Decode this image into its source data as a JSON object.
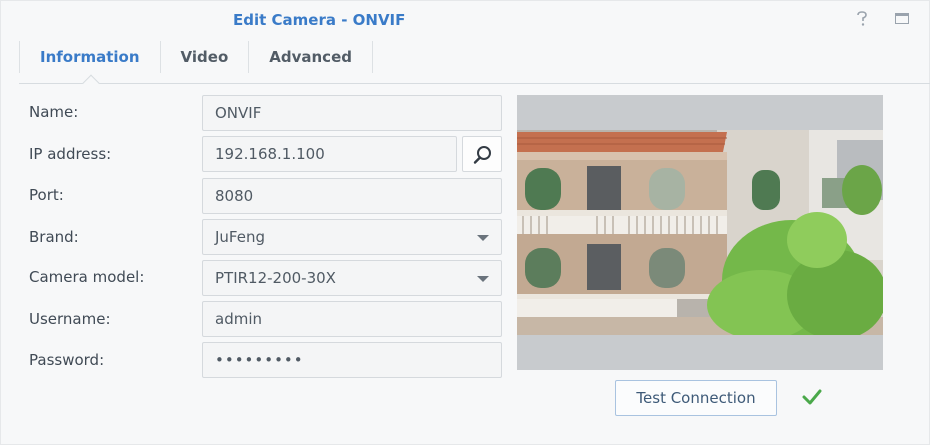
{
  "window": {
    "title": "Edit Camera - ONVIF"
  },
  "icons": {
    "help": "help-icon",
    "maximize": "maximize-icon",
    "search": "search-icon",
    "dropdown": "chevron-down-icon",
    "success": "check-icon"
  },
  "tabs": [
    {
      "label": "Information",
      "active": true
    },
    {
      "label": "Video",
      "active": false
    },
    {
      "label": "Advanced",
      "active": false
    }
  ],
  "form": {
    "name": {
      "label": "Name:",
      "value": "ONVIF"
    },
    "ip": {
      "label": "IP address:",
      "value": "192.168.1.100"
    },
    "port": {
      "label": "Port:",
      "value": "8080"
    },
    "brand": {
      "label": "Brand:",
      "value": "JuFeng"
    },
    "model": {
      "label": "Camera model:",
      "value": "PTIR12-200-30X"
    },
    "username": {
      "label": "Username:",
      "value": "admin"
    },
    "password": {
      "label": "Password:",
      "value": "•••••••••"
    }
  },
  "preview": {
    "test_button": "Test Connection",
    "status": "success"
  },
  "colors": {
    "accent": "#3a7bc8",
    "success": "#4aa84a"
  }
}
